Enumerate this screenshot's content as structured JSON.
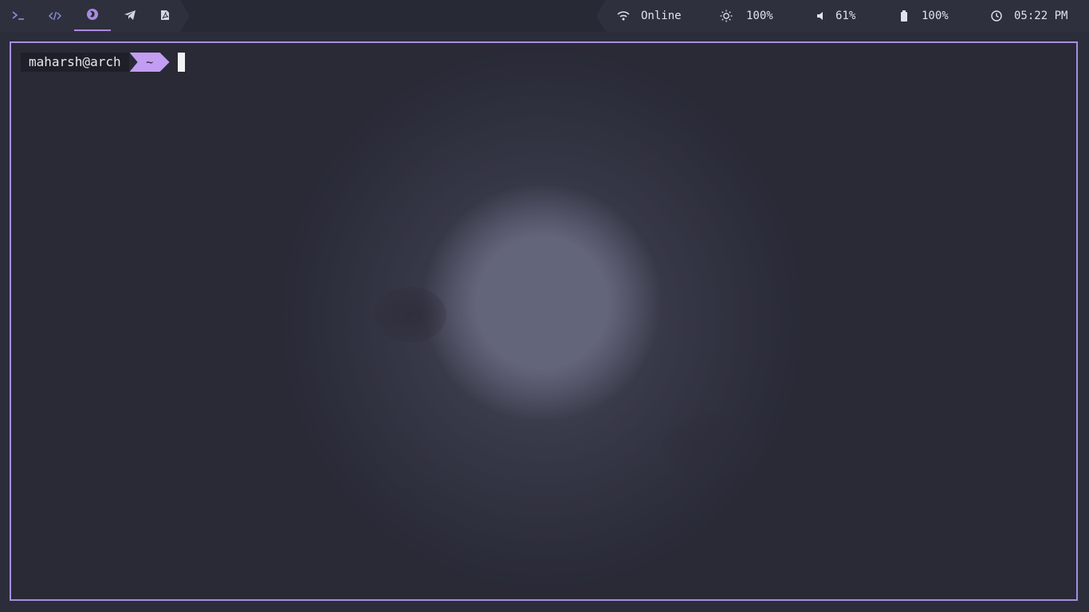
{
  "colors": {
    "accent": "#a88ee0",
    "bar_bg": "#272935",
    "pill_bg": "#2e303d",
    "text": "#e1e2ec",
    "prompt_dir_bg": "#c29df2"
  },
  "workspaces": [
    {
      "icon": "terminal-icon",
      "active": false
    },
    {
      "icon": "code-icon",
      "active": false
    },
    {
      "icon": "firefox-icon",
      "active": true
    },
    {
      "icon": "telegram-icon",
      "active": false
    },
    {
      "icon": "pdf-icon",
      "active": false
    }
  ],
  "status": {
    "network": {
      "icon": "wifi-icon",
      "label": "Online"
    },
    "brightness": {
      "icon": "brightness-icon",
      "value": "100%"
    },
    "volume": {
      "icon": "volume-icon",
      "value": "61%"
    },
    "battery": {
      "icon": "battery-icon",
      "value": "100%"
    },
    "clock": {
      "icon": "clock-icon",
      "value": "05:22 PM"
    }
  },
  "terminal": {
    "user_host": "maharsh@arch",
    "cwd": "~"
  }
}
